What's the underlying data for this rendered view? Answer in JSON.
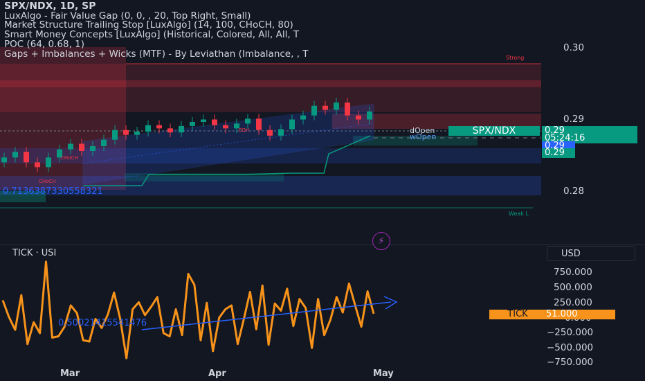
{
  "legend": {
    "symbol": "SPX/NDX, 1D, SP",
    "lines": [
      "LuxAlgo - Fair Value Gap (0, 0, , 20, Top Right, Small)",
      "Market Structure Trailing Stop [LuxAlgo] (14, 100, CHoCH, 80)",
      "Smart Money Concepts [LuxAlgo] (Historical, Colored, All, All, T",
      "POC (64, 0.68, 1)",
      "Gaps + Imbalances + Wicks (MTF) - By Leviathan (Imbalance, , T"
    ]
  },
  "main_axis": {
    "ticks": [
      "0.30",
      "0.29",
      "0.28"
    ],
    "badges": {
      "symbol_label": "SPX/NDX",
      "price": "0.29",
      "countdown": "05:24:16",
      "blue_price": "0.29",
      "green_price": "0.29"
    }
  },
  "annotations": {
    "strong": "Strong",
    "weak": "Weak L",
    "eqh": "EQH",
    "choch": "CHoCH",
    "choch_lower": "CHoCH",
    "dopen": "dOpen",
    "wopen": "wOpen",
    "long_number": "0.7136387330558321",
    "arrow_number": "0.50021415541476"
  },
  "lower_pane": {
    "title": "TICK · USI",
    "currency": "USD",
    "ticks": [
      "750.000",
      "500.000",
      "250.000",
      "0.000",
      "−250.000",
      "−500.000",
      "−750.000"
    ],
    "tick_label": "TICK",
    "tick_value": "51.000"
  },
  "x_axis": [
    "Mar",
    "Apr",
    "May"
  ],
  "colors": {
    "background": "#131722",
    "up": "#089981",
    "down": "#f23645",
    "accent_blue": "#2962ff",
    "tick_line": "#f7931a"
  },
  "chart_data": [
    {
      "type": "line",
      "title": "SPX/NDX, 1D, SP",
      "ylim": [
        0.275,
        0.302
      ],
      "series": [
        {
          "name": "SPX/NDX",
          "values": [
            0.2838,
            0.2845,
            0.2832,
            0.2826,
            0.2838,
            0.2848,
            0.2855,
            0.2846,
            0.2852,
            0.286,
            0.2872,
            0.2866,
            0.287,
            0.2878,
            0.2874,
            0.2869,
            0.2877,
            0.2882,
            0.2885,
            0.2878,
            0.2874,
            0.288,
            0.2886,
            0.2872,
            0.2865,
            0.2873,
            0.2885,
            0.289,
            0.2902,
            0.2897,
            0.2906,
            0.289,
            0.2885,
            0.2895
          ]
        }
      ]
    },
    {
      "type": "line",
      "title": "TICK · USI",
      "ylim": [
        -800,
        900
      ],
      "series": [
        {
          "name": "TICK",
          "values": [
            260,
            0,
            -200,
            340,
            -420,
            -80,
            -250,
            860,
            -320,
            -300,
            -150,
            180,
            60,
            -360,
            -380,
            -30,
            -170,
            40,
            380,
            -30,
            -640,
            120,
            230,
            30,
            160,
            310,
            -250,
            -300,
            120,
            -280,
            670,
            500,
            -360,
            220,
            -530,
            -10,
            120,
            180,
            -420,
            -30,
            390,
            -190,
            490,
            -430,
            210,
            100,
            440,
            -140,
            280,
            140,
            -480,
            280,
            -280,
            -40,
            310,
            70,
            520,
            180,
            -150,
            400,
            51
          ]
        }
      ]
    }
  ]
}
